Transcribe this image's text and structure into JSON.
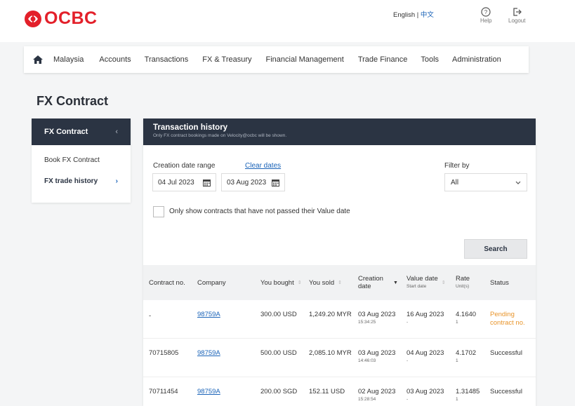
{
  "header": {
    "logo_text": "OCBC",
    "lang_en": "English",
    "lang_sep": " | ",
    "lang_zh": "中文",
    "help_label": "Help",
    "logout_label": "Logout",
    "brand_color": "#e3202a"
  },
  "nav": {
    "home_icon": "home-icon",
    "items": [
      "Malaysia",
      "Accounts",
      "Transactions",
      "FX & Treasury",
      "Financial Management",
      "Trade Finance",
      "Tools",
      "Administration"
    ]
  },
  "page_title": "FX Contract",
  "side": {
    "title": "FX Contract",
    "collapse_icon": "chevron-left-icon",
    "items": [
      {
        "label": "Book FX Contract",
        "active": false
      },
      {
        "label": "FX trade history",
        "active": true
      }
    ]
  },
  "card": {
    "title": "Transaction history",
    "subtitle": "Only FX contract bookings made on Velocity@ocbc will be shown.",
    "date_range_label": "Creation date range",
    "clear_dates": "Clear dates",
    "date_from": "04 Jul 2023",
    "date_to": "03 Aug 2023",
    "filter_label": "Filter by",
    "filter_value": "All",
    "checkbox_label": "Only show contracts that have not passed their Value date",
    "search_label": "Search"
  },
  "table": {
    "headers": {
      "contract": "Contract no.",
      "company": "Company",
      "bought": "You bought",
      "sold": "You sold",
      "creation": "Creation\ndate",
      "value": "Value date",
      "value_sub": "Start date",
      "rate": "Rate",
      "rate_sub": "Unit(s)",
      "status": "Status"
    },
    "rows": [
      {
        "contract": "-",
        "company": "98759A",
        "bought": "300.00 USD",
        "sold": "1,249.20 MYR",
        "created": "03 Aug 2023",
        "created_time": "15:34:25",
        "value": "16 Aug 2023",
        "value_sub": "-",
        "rate": "4.1640",
        "rate_unit": "1",
        "status": "Pending contract no.",
        "pending": true
      },
      {
        "contract": "70715805",
        "company": "98759A",
        "bought": "500.00 USD",
        "sold": "2,085.10 MYR",
        "created": "03 Aug 2023",
        "created_time": "14:46:03",
        "value": "04 Aug 2023",
        "value_sub": "-",
        "rate": "4.1702",
        "rate_unit": "1",
        "status": "Successful",
        "pending": false
      },
      {
        "contract": "70711454",
        "company": "98759A",
        "bought": "200.00 SGD",
        "sold": "152.11 USD",
        "created": "02 Aug 2023",
        "created_time": "15:28:54",
        "value": "03 Aug 2023",
        "value_sub": "-",
        "rate": "1.31485",
        "rate_unit": "1",
        "status": "Successful",
        "pending": false
      }
    ]
  }
}
